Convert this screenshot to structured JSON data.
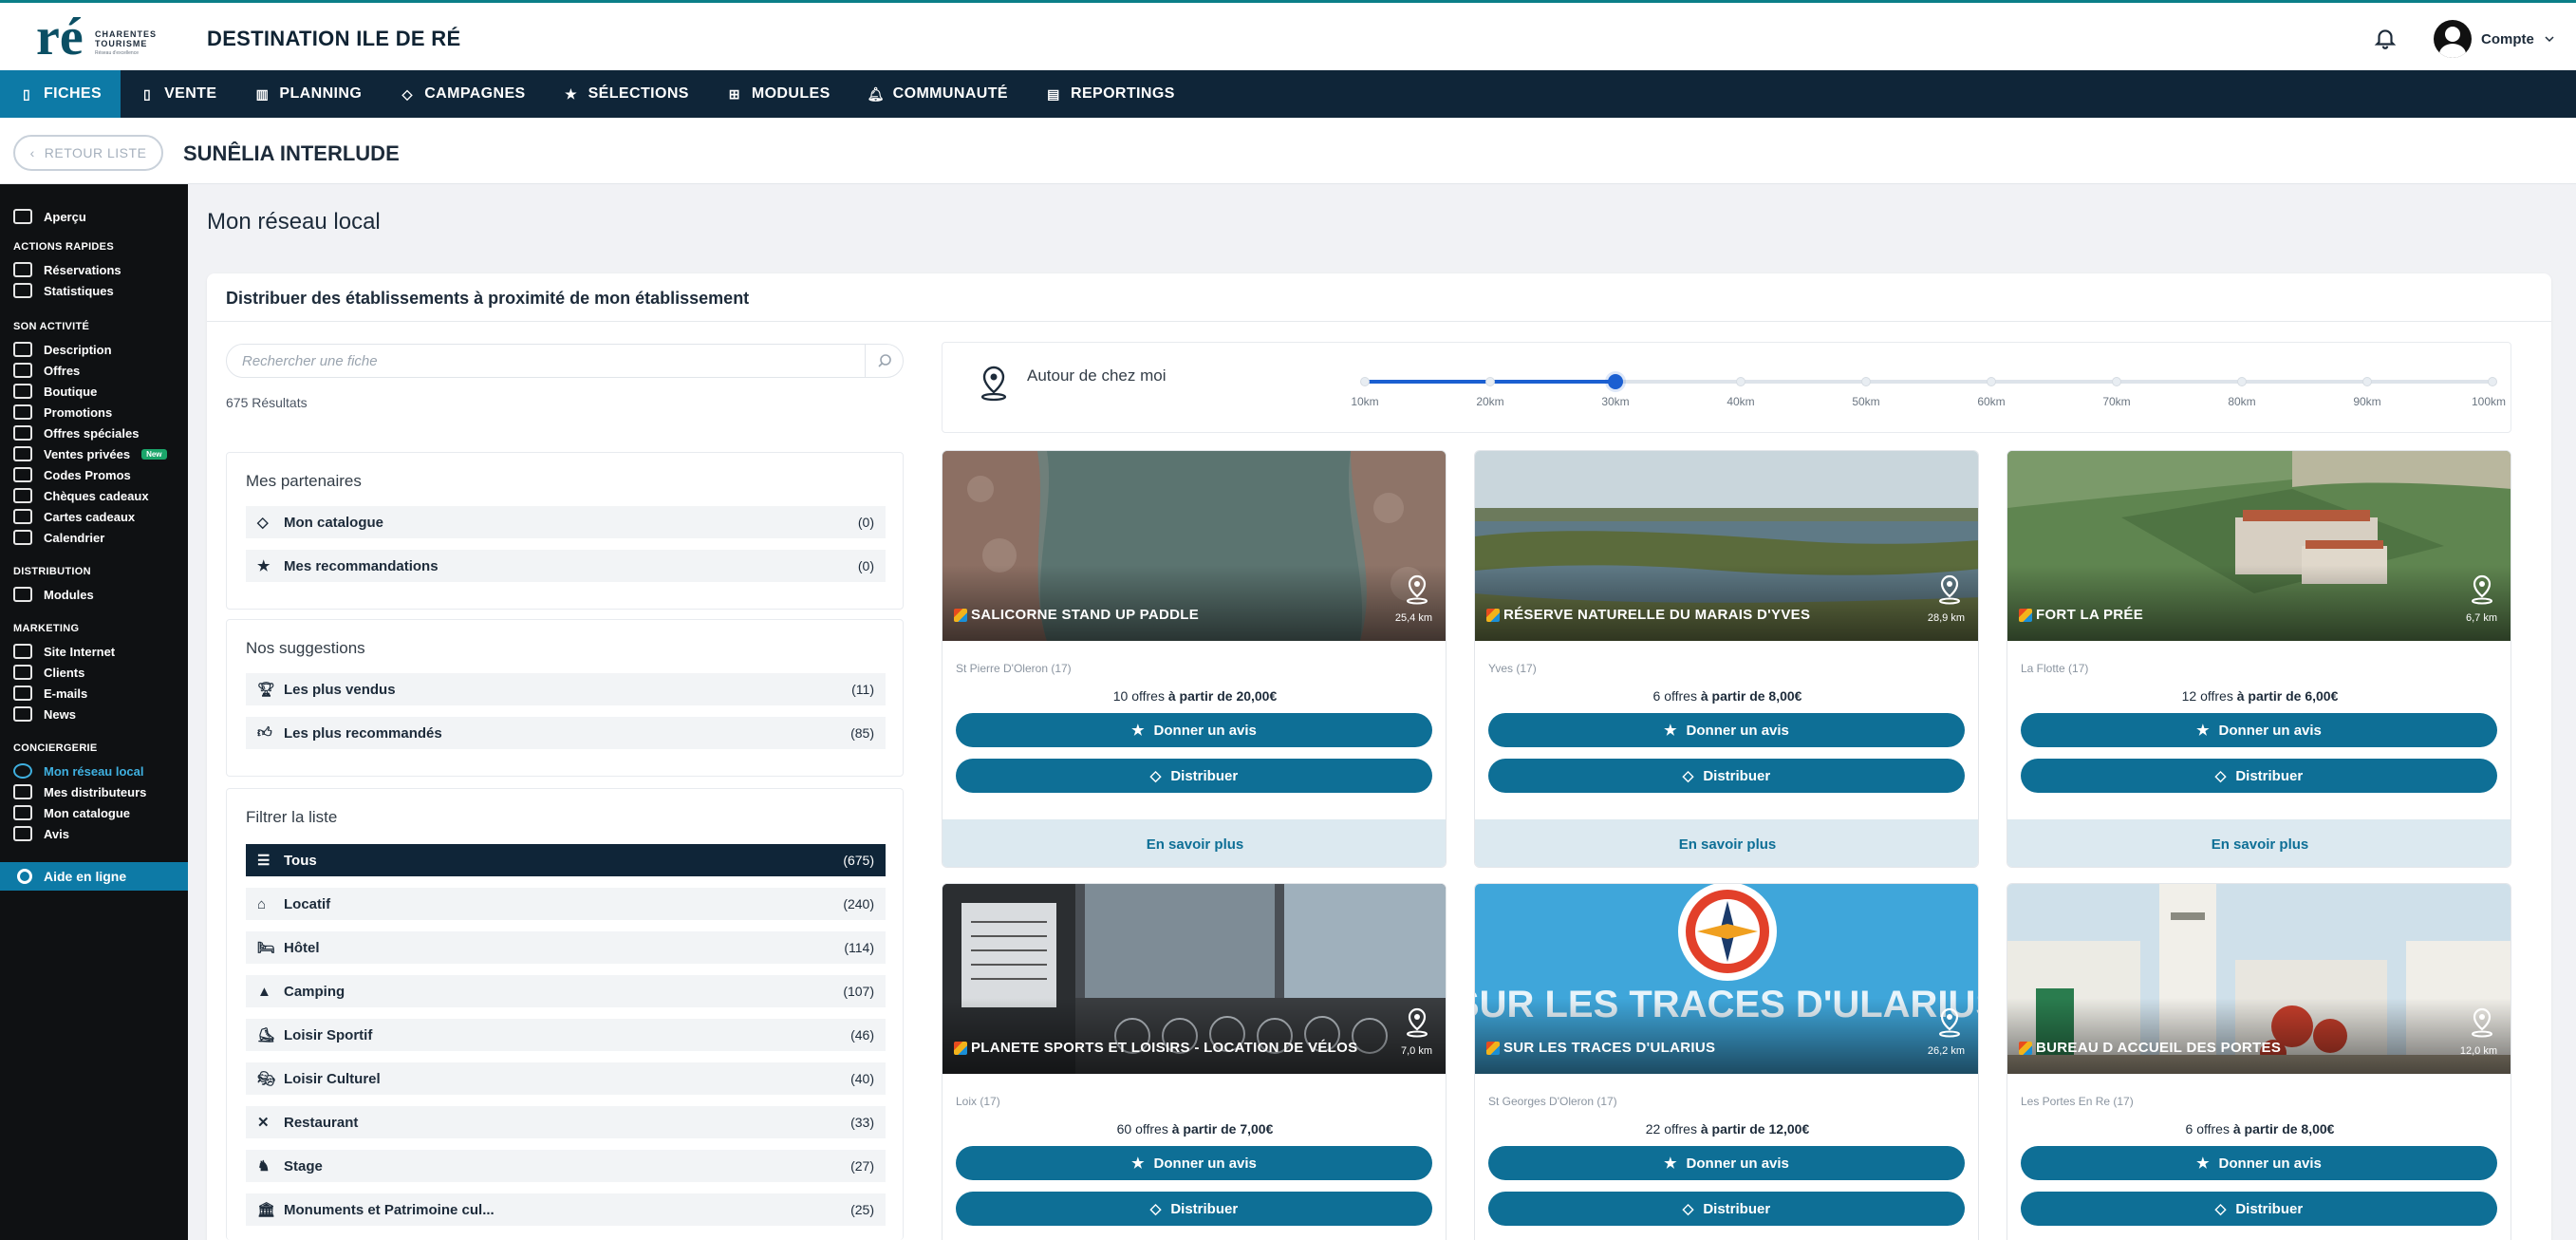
{
  "brand": {
    "logo_mark": "ré",
    "logo_text_1": "CHARENTES",
    "logo_text_2": "TOURISME",
    "logo_sub": "Réseau d'excellence"
  },
  "header": {
    "app_title": "DESTINATION ILE DE RÉ",
    "account_label": "Compte"
  },
  "nav": [
    {
      "label": "FICHES",
      "icon": "document-icon",
      "active": true
    },
    {
      "label": "VENTE",
      "icon": "receipt-icon"
    },
    {
      "label": "PLANNING",
      "icon": "chart-icon"
    },
    {
      "label": "CAMPAGNES",
      "icon": "tag-icon"
    },
    {
      "label": "SÉLECTIONS",
      "icon": "star-icon"
    },
    {
      "label": "MODULES",
      "icon": "grid-icon"
    },
    {
      "label": "COMMUNAUTÉ",
      "icon": "bell-icon"
    },
    {
      "label": "REPORTINGS",
      "icon": "report-icon"
    }
  ],
  "subheader": {
    "back_label": "RETOUR LISTE",
    "establishment": "SUNÊLIA INTERLUDE"
  },
  "sidebar": {
    "overview": "Aperçu",
    "sections": {
      "actions": "ACTIONS RAPIDES",
      "activity": "SON ACTIVITÉ",
      "distribution": "DISTRIBUTION",
      "marketing": "MARKETING",
      "conciergerie": "CONCIERGERIE"
    },
    "actions_items": [
      "Réservations",
      "Statistiques"
    ],
    "activity_items": [
      "Description",
      "Offres",
      "Boutique",
      "Promotions",
      "Offres spéciales",
      "Ventes privées",
      "Codes Promos",
      "Chèques cadeaux",
      "Cartes cadeaux",
      "Calendrier"
    ],
    "new_badge": "New",
    "distribution_items": [
      "Modules"
    ],
    "marketing_items": [
      "Site Internet",
      "Clients",
      "E-mails",
      "News"
    ],
    "conciergerie_items": [
      "Mon réseau local",
      "Mes distributeurs",
      "Mon catalogue",
      "Avis"
    ],
    "help": "Aide en ligne"
  },
  "main": {
    "title": "Mon réseau local",
    "panel_title": "Distribuer des établissements à proximité de mon établissement",
    "search_placeholder": "Rechercher une fiche",
    "result_count": "675 Résultats"
  },
  "partners": {
    "title": "Mes partenaires",
    "rows": [
      {
        "label": "Mon catalogue",
        "count": "(0)",
        "icon": "tag-icon"
      },
      {
        "label": "Mes recommandations",
        "count": "(0)",
        "icon": "star-icon"
      }
    ]
  },
  "suggestions": {
    "title": "Nos suggestions",
    "rows": [
      {
        "label": "Les plus vendus",
        "count": "(11)",
        "icon": "trophy-icon"
      },
      {
        "label": "Les plus recommandés",
        "count": "(85)",
        "icon": "thumbs-up-icon"
      }
    ]
  },
  "filter": {
    "title": "Filtrer la liste",
    "rows": [
      {
        "label": "Tous",
        "count": "(675)",
        "icon": "list-icon",
        "active": true
      },
      {
        "label": "Locatif",
        "count": "(240)",
        "icon": "house-icon"
      },
      {
        "label": "Hôtel",
        "count": "(114)",
        "icon": "bed-icon"
      },
      {
        "label": "Camping",
        "count": "(107)",
        "icon": "tent-icon"
      },
      {
        "label": "Loisir Sportif",
        "count": "(46)",
        "icon": "skate-icon"
      },
      {
        "label": "Loisir Culturel",
        "count": "(40)",
        "icon": "mask-icon"
      },
      {
        "label": "Restaurant",
        "count": "(33)",
        "icon": "cutlery-icon"
      },
      {
        "label": "Stage",
        "count": "(27)",
        "icon": "stage-icon"
      },
      {
        "label": "Monuments et Patrimoine cul...",
        "count": "(25)",
        "icon": "monument-icon"
      }
    ]
  },
  "distance": {
    "label": "Autour de chez moi",
    "ticks": [
      "10km",
      "20km",
      "30km",
      "40km",
      "50km",
      "60km",
      "70km",
      "80km",
      "90km",
      "100km"
    ],
    "selected": "30km"
  },
  "cards": [
    {
      "name": "SALICORNE STAND UP PADDLE",
      "distance": "25,4 km",
      "city": "St Pierre D'Oleron (17)",
      "offers": "10 offres",
      "price": "à partir de 20,00€",
      "image": "aerial-river"
    },
    {
      "name": "RÉSERVE NATURELLE DU MARAIS D'YVES",
      "distance": "28,9 km",
      "city": "Yves (17)",
      "offers": "6 offres",
      "price": "à partir de 8,00€",
      "image": "marsh"
    },
    {
      "name": "FORT LA PRÉE",
      "distance": "6,7 km",
      "city": "La Flotte (17)",
      "offers": "12 offres",
      "price": "à partir de 6,00€",
      "image": "fort"
    },
    {
      "name": "PLANETE SPORTS ET LOISIRS - LOCATION DE VÉLOS",
      "distance": "7,0 km",
      "city": "Loix (17)",
      "offers": "60 offres",
      "price": "à partir de 7,00€",
      "image": "bike-shop"
    },
    {
      "name": "SUR LES TRACES D'ULARIUS",
      "distance": "26,2 km",
      "city": "St Georges D'Oleron (17)",
      "offers": "22 offres",
      "price": "à partir de 12,00€",
      "image": "ularius",
      "image_text": "SUR LES TRACES D'ULARIUS"
    },
    {
      "name": "BUREAU D ACCUEIL DES PORTES",
      "distance": "12,0 km",
      "city": "Les Portes En Re (17)",
      "offers": "6 offres",
      "price": "à partir de 8,00€",
      "image": "village"
    }
  ],
  "card_actions": {
    "review": "Donner un avis",
    "distribute": "Distribuer",
    "more": "En savoir plus"
  },
  "colors": {
    "nav_bg": "#0f2538",
    "active_blue": "#0d7aa6",
    "button_blue": "#0e6f96",
    "slider_blue": "#1b5fd1",
    "sidebar_bg": "#0f1113"
  }
}
